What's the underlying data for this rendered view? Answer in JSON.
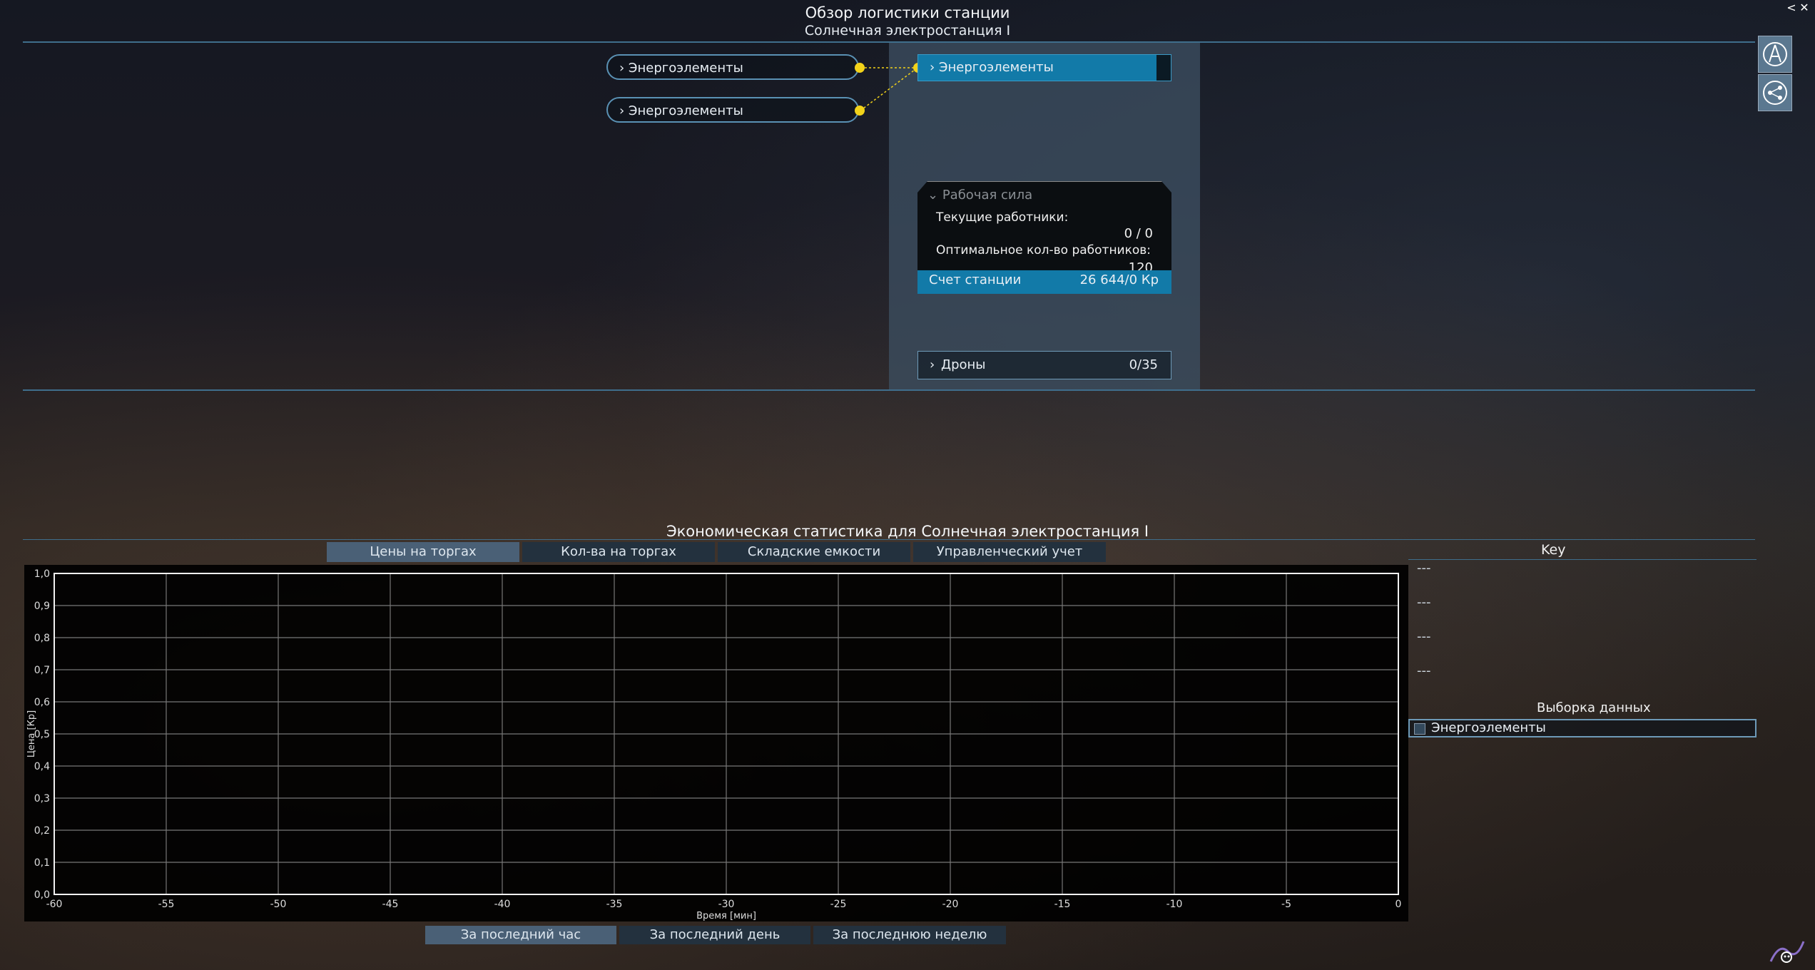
{
  "header": {
    "title": "Обзор логистики станции",
    "subtitle": "Солнечная электростанция I",
    "close_glyph": "✕",
    "back_glyph": "<"
  },
  "logistics": {
    "input_nodes": [
      "Энергоэлементы",
      "Энергоэлементы"
    ],
    "output_node": "Энергоэлементы",
    "connector_color": "#f2d21a",
    "workforce": {
      "header": "Рабочая сила",
      "current_label": "Текущие работники:",
      "current_value": "0 / 0",
      "optimal_label": "Оптимальное кол-во работников:",
      "optimal_value": "120"
    },
    "account": {
      "label": "Счет станции",
      "value": "26 644/0 Кр"
    },
    "drones": {
      "label": "Дроны",
      "value": "0/35"
    }
  },
  "side_icons": [
    "compass-icon",
    "network-icon"
  ],
  "stats": {
    "title": "Экономическая статистика для Солнечная электростанция I",
    "tabs": [
      "Цены на торгах",
      "Кол-ва на торгах",
      "Складские емкости",
      "Управленческий учет"
    ],
    "active_tab": 0,
    "key_title": "Key",
    "key_entries": [
      "---",
      "---",
      "---",
      "---"
    ],
    "selection_title": "Выборка данных",
    "selection_items": [
      "Энергоэлементы"
    ],
    "periods": [
      "За последний час",
      "За последний день",
      "За последнюю неделю"
    ],
    "active_period": 0
  },
  "chart_data": {
    "type": "line",
    "title": "",
    "xlabel": "Время [мин]",
    "ylabel": "Цена [Кр]",
    "xlim": [
      -60,
      0
    ],
    "ylim": [
      0,
      1
    ],
    "x_ticks": [
      "-60",
      "-55",
      "-50",
      "-45",
      "-40",
      "-35",
      "-30",
      "-25",
      "-20",
      "-15",
      "-10",
      "-5",
      "0"
    ],
    "y_ticks": [
      "0,0",
      "0,1",
      "0,2",
      "0,3",
      "0,4",
      "0,5",
      "0,6",
      "0,7",
      "0,8",
      "0,9",
      "1,0"
    ],
    "grid": true,
    "series": []
  }
}
